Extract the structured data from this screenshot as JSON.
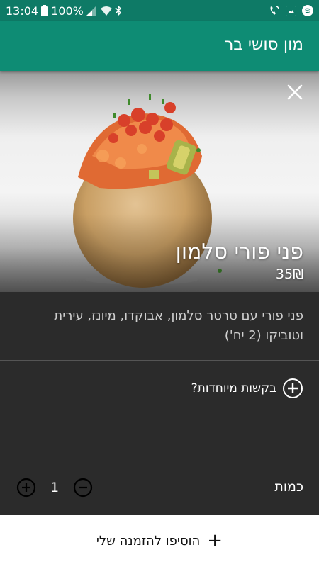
{
  "status_bar": {
    "time": "13:04",
    "battery": "100%",
    "icons": [
      "battery-icon",
      "signal-icon",
      "wifi-icon",
      "bluetooth-icon",
      "wifi-call-icon",
      "image-icon",
      "spotify-icon"
    ]
  },
  "header": {
    "title": "מון סושי בר"
  },
  "item": {
    "name": "פני פורי סלמון",
    "price": "35₪",
    "description": "פני פורי עם טרטר סלמון, אבוקדו, מיונז, עירית וטוביקו (2 יח')"
  },
  "special_requests": {
    "label": "בקשות מיוחדות?"
  },
  "quantity": {
    "label": "כמות",
    "value": "1"
  },
  "add_button": {
    "label": "הוסיפו להזמנה שלי",
    "plus": "+"
  },
  "colors": {
    "status_bar": "#0e7a66",
    "app_bar": "#0e8c74",
    "panel": "#2b2b2b",
    "add_bar": "#ffffff"
  }
}
